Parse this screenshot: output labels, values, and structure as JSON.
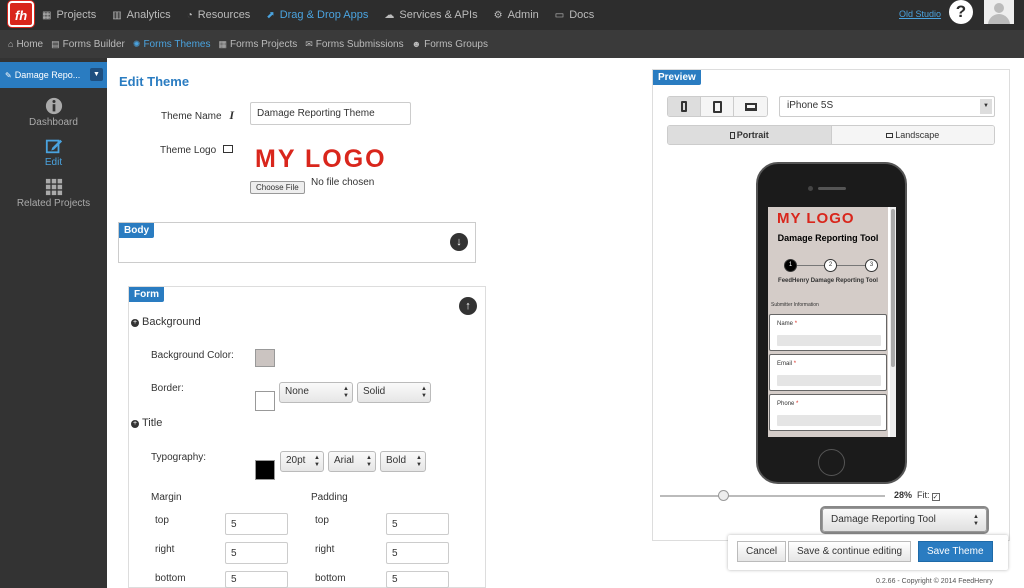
{
  "topbar": {
    "items": [
      {
        "label": "Projects",
        "icon": "grid-icon"
      },
      {
        "label": "Analytics",
        "icon": "bar-chart-icon"
      },
      {
        "label": "Resources",
        "icon": "dashboard-icon"
      },
      {
        "label": "Drag & Drop Apps",
        "icon": "cursor-icon",
        "active": true
      },
      {
        "label": "Services & APIs",
        "icon": "cloud-icon"
      },
      {
        "label": "Admin",
        "icon": "cogs-icon"
      },
      {
        "label": "Docs",
        "icon": "folder-icon"
      }
    ],
    "old_studio": "Old Studio",
    "logo_text": "fh"
  },
  "subnav": {
    "items": [
      {
        "label": "Home"
      },
      {
        "label": "Forms Builder"
      },
      {
        "label": "Forms Themes",
        "active": true
      },
      {
        "label": "Forms Projects"
      },
      {
        "label": "Forms Submissions"
      },
      {
        "label": "Forms Groups"
      }
    ]
  },
  "sidebar": {
    "project": "Damage Repo...",
    "items": [
      {
        "label": "Dashboard"
      },
      {
        "label": "Edit",
        "active": true
      },
      {
        "label": "Related Projects"
      }
    ]
  },
  "editor": {
    "title": "Edit Theme",
    "theme_name_label": "Theme Name",
    "theme_name_value": "Damage Reporting Theme",
    "theme_logo_label": "Theme Logo",
    "logo_text": "MY LOGO",
    "choose_file": "Choose File",
    "no_file": "No file chosen",
    "body_tag": "Body",
    "form_tag": "Form",
    "background_head": "Background",
    "background_color_label": "Background Color:",
    "background_color": "#cbc4c1",
    "border_label": "Border:",
    "border_color": "#ffffff",
    "border_width": "None",
    "border_style": "Solid",
    "title_head": "Title",
    "typography_label": "Typography:",
    "typography_color": "#000000",
    "font_size": "20pt",
    "font_family": "Arial",
    "font_weight": "Bold",
    "margin_label": "Margin",
    "padding_label": "Padding",
    "margin": {
      "top_label": "top",
      "top": "5",
      "right_label": "right",
      "right": "5",
      "bottom_label": "bottom",
      "bottom": "5"
    },
    "padding": {
      "top_label": "top",
      "top": "5",
      "right_label": "right",
      "right": "5",
      "bottom_label": "bottom",
      "bottom": "5"
    }
  },
  "preview": {
    "tag": "Preview",
    "device": "iPhone 5S",
    "portrait": "Portrait",
    "landscape": "Landscape",
    "screen": {
      "logo": "MY LOGO",
      "title": "Damage Reporting Tool",
      "steps": [
        "1",
        "2",
        "3"
      ],
      "subtitle": "FeedHenry Damage Reporting Tool",
      "section": "Submitter Information",
      "fields": [
        "Name",
        "Email",
        "Phone"
      ],
      "required_mark": "*"
    },
    "zoom": "28%",
    "fit_label": "Fit:",
    "form_select": "Damage Reporting Tool"
  },
  "actions": {
    "cancel": "Cancel",
    "save_continue": "Save & continue editing",
    "save": "Save Theme"
  },
  "footer": "0.2.66 - Copyright © 2014 FeedHenry"
}
